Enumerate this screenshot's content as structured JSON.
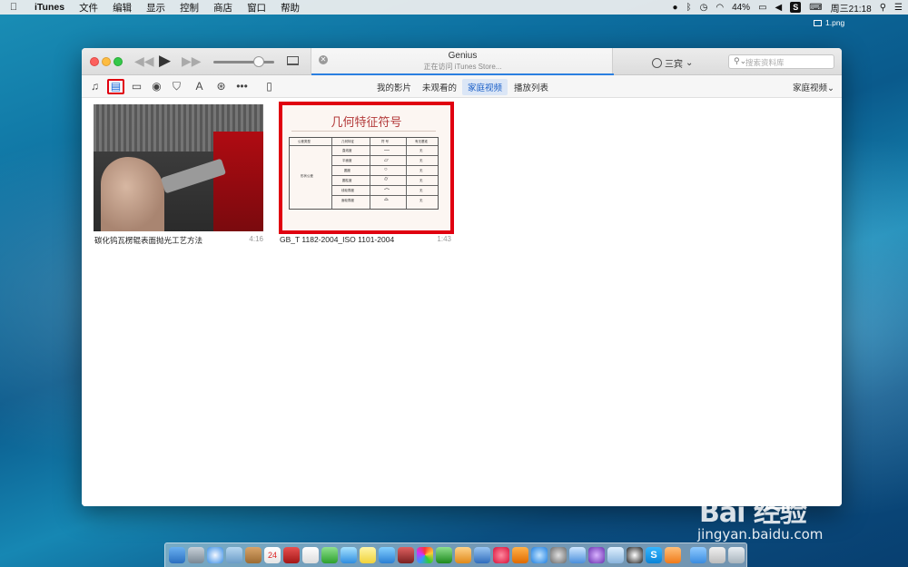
{
  "menubar": {
    "app_name": "iTunes",
    "menus": [
      "文件",
      "编辑",
      "显示",
      "控制",
      "商店",
      "窗口",
      "帮助"
    ],
    "battery": "44%",
    "clock": "周三21:18"
  },
  "desktop": {
    "file_label": "1.png"
  },
  "titlebar": {
    "lcd_title": "Genius",
    "lcd_subtitle": "正在访问 iTunes Store...",
    "account_name": "三宾",
    "search_placeholder": "搜索资料库"
  },
  "nav": {
    "tabs": [
      "我的影片",
      "未观看的",
      "家庭视频",
      "播放列表"
    ],
    "active_tab": "家庭视频",
    "view_select": "家庭视频"
  },
  "media_icons": [
    "music-icon",
    "movies-icon",
    "tv-icon",
    "podcast-icon",
    "itunes-u-icon",
    "apps-icon",
    "radio-icon",
    "more-icon",
    "iphone-icon"
  ],
  "library": {
    "items": [
      {
        "title": "碳化钨瓦楞辊表面抛光工艺方法",
        "duration": "4:16"
      },
      {
        "title": "GB_T 1182-2004_ISO 1101-2004",
        "duration": "1:43"
      }
    ]
  },
  "document_thumb": {
    "heading": "几何特征符号",
    "table_header": [
      "公差类型",
      "几何特征",
      "符  号",
      "有无基准"
    ],
    "group_label": "形状公差",
    "rows": [
      {
        "feature": "直线度",
        "symbol": "—",
        "datum": "无"
      },
      {
        "feature": "平面度",
        "symbol": "▱",
        "datum": "无"
      },
      {
        "feature": "圆度",
        "symbol": "○",
        "datum": "无"
      },
      {
        "feature": "圆柱度",
        "symbol": "⌭",
        "datum": "无"
      },
      {
        "feature": "线轮廓度",
        "symbol": "⌒",
        "datum": "无"
      },
      {
        "feature": "面轮廓度",
        "symbol": "⌓",
        "datum": "无"
      }
    ]
  },
  "watermark": {
    "brand": "Bai  经验",
    "url": "jingyan.baidu.com"
  },
  "colors": {
    "highlight_red": "#e00010",
    "accent_blue": "#2b7fe0"
  }
}
